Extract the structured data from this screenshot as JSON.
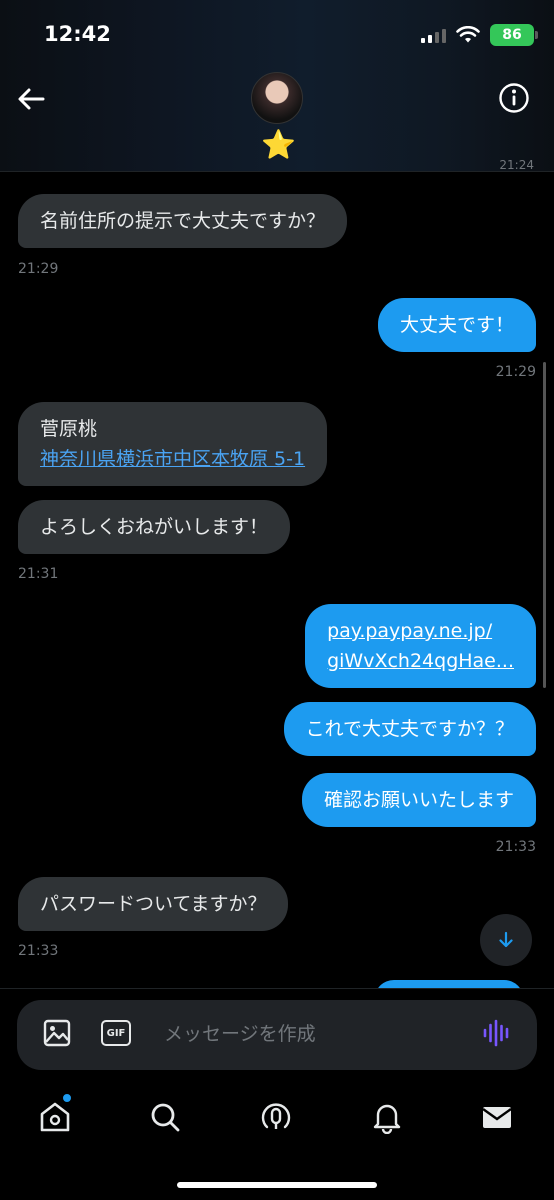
{
  "status_bar": {
    "time": "12:42",
    "battery": "86"
  },
  "header": {
    "star": "⭐",
    "edge_time": "21:24"
  },
  "messages": [
    {
      "text": "名前住所の提示で大丈夫ですか？",
      "time": "21:29"
    },
    {
      "text": "大丈夫です！",
      "time": "21:29"
    },
    {
      "name": "菅原桃",
      "address": "神奈川県横浜市中区本牧原 5-1"
    },
    {
      "text": "よろしくおねがいします！",
      "time": "21:31"
    },
    {
      "link_line1": "pay.paypay.ne.jp/",
      "link_line2": "giWvXch24qgHae..."
    },
    {
      "text": "これで大丈夫ですか？？"
    },
    {
      "text": "確認お願いいたします",
      "time": "21:33"
    },
    {
      "text": "パスワードついてますか？",
      "time": "21:33"
    }
  ],
  "composer": {
    "placeholder": "メッセージを作成",
    "gif_label": "GIF"
  },
  "icons": {
    "back": "back-arrow-icon",
    "info": "info-icon",
    "scroll_down": "arrow-down-icon",
    "media": "image-icon",
    "voice": "voice-waveform-icon",
    "nav": [
      "home-icon",
      "search-icon",
      "spaces-icon",
      "bell-icon",
      "mail-icon"
    ]
  },
  "colors": {
    "accent": "#1d9bf0",
    "received_bubble": "#2f3336",
    "background": "#000000",
    "voice": "#7856ff"
  }
}
